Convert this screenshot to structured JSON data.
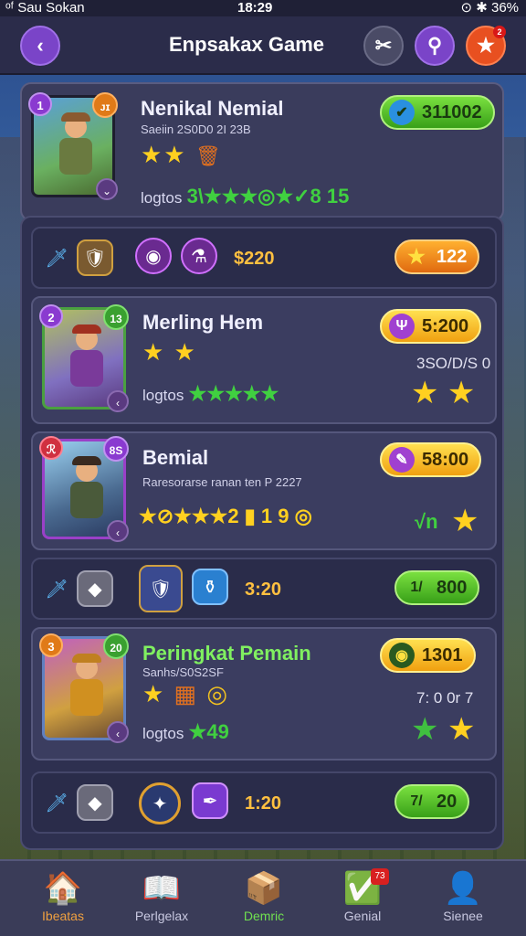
{
  "status": {
    "left": "ᵒᶠ Sau Sokan",
    "time": "18:29",
    "right": "⊙ ✱ 36%"
  },
  "header": {
    "title": "Enpsakax Game",
    "back_icon": "‹",
    "tool_icon": "✂",
    "search_icon": "⚲",
    "star_icon": "★"
  },
  "players": [
    {
      "rank": "1",
      "level": "ᴊɪ",
      "name": "Nenikal Nemial",
      "sub": "Saeiin 2S0D0 2I 23B",
      "log_label": "logtos",
      "log_value": "3\\★★★◎★✓8 15",
      "pill_value": "311002",
      "pill_icon": "✔",
      "stars": "★★",
      "extra": "🗑"
    },
    {
      "rank": "2",
      "level": "13",
      "name": "Merling Hem",
      "log_label": "logtos",
      "log_value": "★★★★★",
      "pill_value": "5:200",
      "pill_icon": "Ψ",
      "stars": "★ ★",
      "note": "3SO/D/S 0",
      "rtstars": "★ ★"
    },
    {
      "rank": "ℛ",
      "level": "8S",
      "name": "Bemial",
      "sub": "Raresorarse ranan ten P 2227",
      "log_value": "★⊘★★★2 ▮ 1 9 ◎",
      "pill_value": "58:00",
      "pill_icon": "✎",
      "note": "√n",
      "rtstars": "★"
    },
    {
      "rank": "3",
      "level": "20",
      "name": "Peringkat Pemain",
      "sub": "Sanhs/S0S2SF",
      "log_label": "logtos",
      "log_value": "★49",
      "pill_value": "1301",
      "pill_icon": "◉",
      "note": "7: 0 0r 7",
      "rtstars": "★ ★"
    }
  ],
  "rows": [
    {
      "price": "$220",
      "pill": "122",
      "pill_icon": "★"
    },
    {
      "price": "3:20",
      "pill": "800",
      "pill_icon": "1/"
    },
    {
      "price": "1:20",
      "pill": "20",
      "pill_icon": "7/"
    }
  ],
  "nav": [
    {
      "label": "Ibeatas",
      "icon": "🏠"
    },
    {
      "label": "Perlgelax",
      "icon": "📖"
    },
    {
      "label": "Demric",
      "icon": "📦"
    },
    {
      "label": "Genial",
      "icon": "✅",
      "badge": "73"
    },
    {
      "label": "Sienee",
      "icon": "👤"
    }
  ]
}
